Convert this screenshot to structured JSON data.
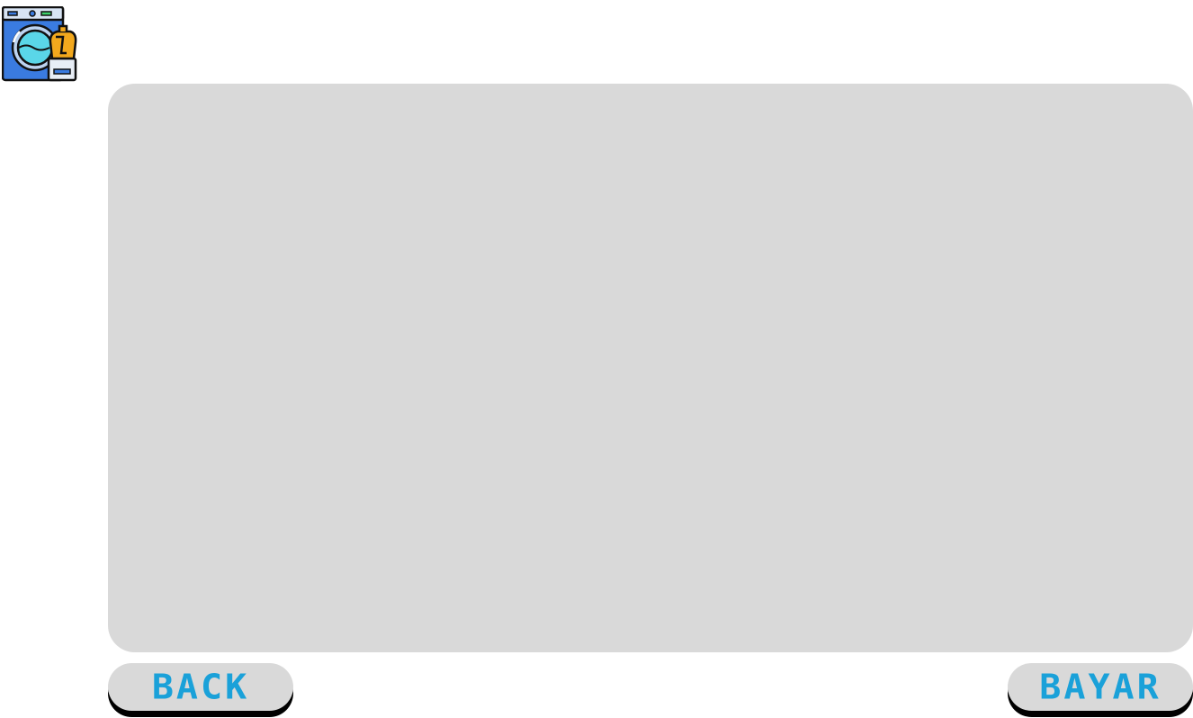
{
  "app": {
    "logo_icon": "washing-machine-detergent-icon"
  },
  "main": {
    "panel": {}
  },
  "footer": {
    "back_label": "BACK",
    "pay_label": "BAYAR"
  },
  "colors": {
    "panel_bg": "#d9d9d9",
    "button_text": "#1aa1d9",
    "button_shadow": "#000000",
    "machine_body": "#3a7be0",
    "machine_drum": "#5ad6e8",
    "detergent": "#f2a81d"
  }
}
